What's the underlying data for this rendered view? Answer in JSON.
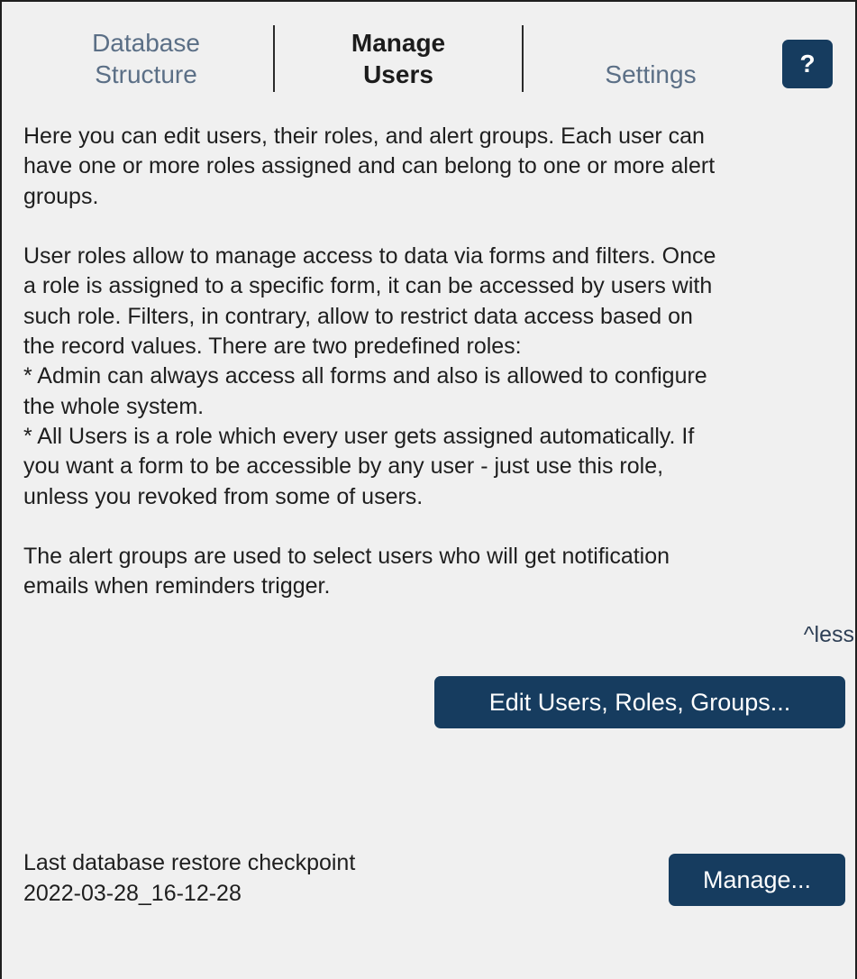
{
  "tabs": {
    "database_structure": [
      "Database",
      "Structure"
    ],
    "manage_users": [
      "Manage",
      "Users"
    ],
    "settings": "Settings",
    "help_label": "?"
  },
  "description": {
    "paragraph1": [
      "Here you can edit users, their roles, and alert groups. Each user can",
      "have one or more roles assigned and can belong to one or more alert",
      "groups."
    ],
    "paragraph2": [
      "User roles allow to manage access to data via forms and filters. Once",
      "a role is assigned to a specific form, it can be accessed by users with",
      "such role. Filters, in contrary, allow to restrict data access based on",
      "the record values. There are two predefined roles:",
      "* Admin can always access all forms and also is allowed to configure",
      "the whole system.",
      "* All Users is a role which every user gets assigned automatically. If",
      "you want a form to be accessible by any user - just use this role,",
      "unless you revoked from some of users."
    ],
    "paragraph3": [
      "The alert groups are used to select users who will get notification",
      "emails when reminders trigger."
    ]
  },
  "less_link": "^less",
  "edit_button": "Edit Users, Roles, Groups...",
  "checkpoint": {
    "label": "Last database restore checkpoint",
    "value": "2022-03-28_16-12-28"
  },
  "manage_button": "Manage...",
  "colors": {
    "button_bg": "#163c5f",
    "panel_bg": "#f0f0f0",
    "inactive_tab": "#5b6f86"
  }
}
